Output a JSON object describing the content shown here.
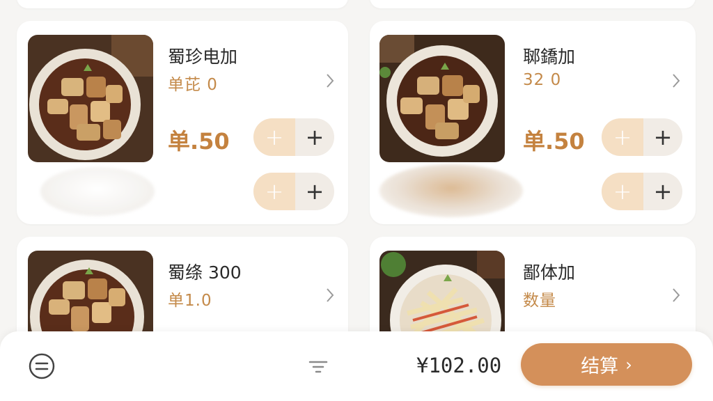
{
  "products": [
    {
      "name": "蜀珍电加",
      "spec": "单芘 0",
      "price": "单.50"
    },
    {
      "name": "郰鐈加",
      "spec": "32  0",
      "price": "单.50"
    },
    {
      "name": "蜀绦 300",
      "spec": "单1.0",
      "price": ""
    },
    {
      "name": "鄙体加",
      "spec": "数量",
      "price": ""
    }
  ],
  "stepper": {
    "minus": "+",
    "plus": "+"
  },
  "icons": {
    "menu": "menu-icon",
    "filter": "filter-icon",
    "chevron": "chevron-right-icon"
  },
  "cart": {
    "total": "¥102.00",
    "checkout_label": "结算",
    "checkout_arrow": "›"
  },
  "colors": {
    "accent": "#d4905a",
    "price": "#c4823f",
    "stepper_light": "#f5dfc4"
  }
}
